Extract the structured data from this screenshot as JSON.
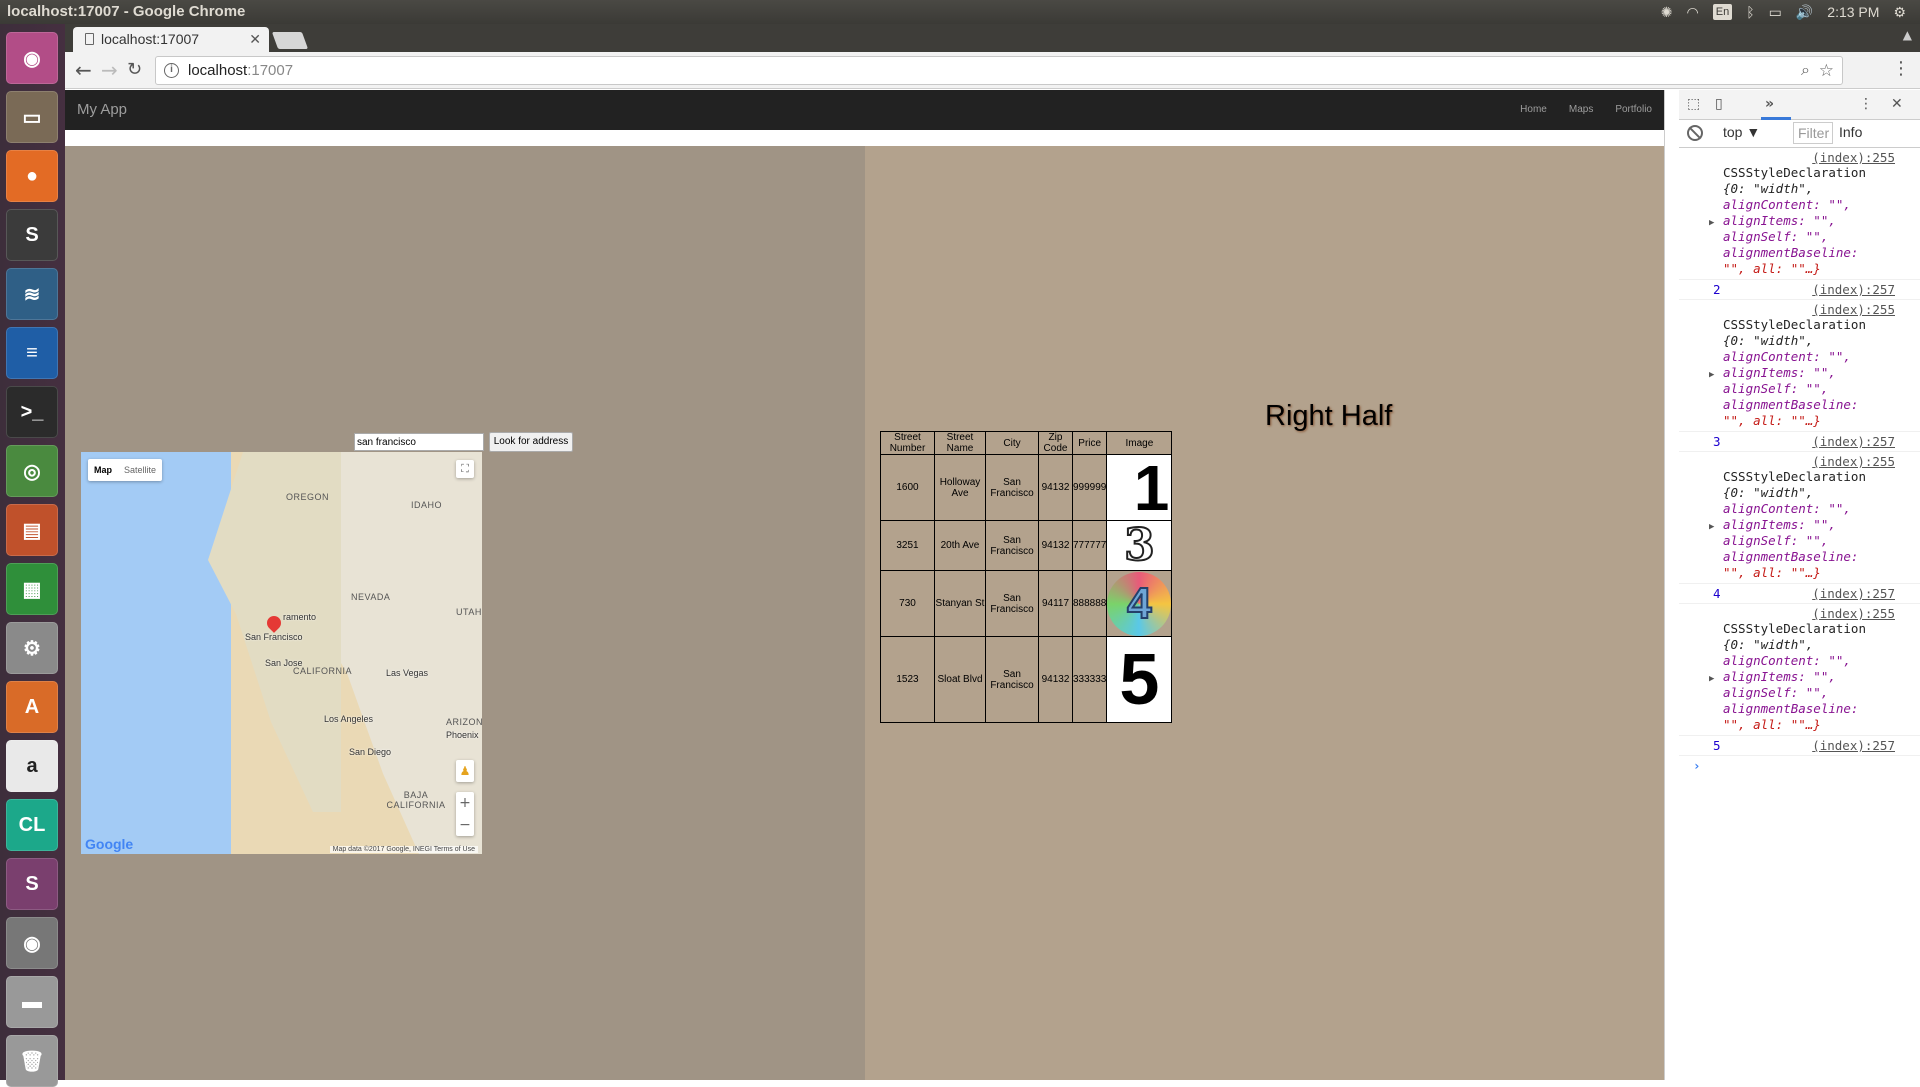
{
  "os": {
    "window_title": "localhost:17007 - Google Chrome",
    "tray": {
      "lang": "En",
      "time": "2:13 PM"
    }
  },
  "launcher": [
    {
      "name": "ubuntu-icon",
      "color": "#b24d87",
      "glyph": "◉"
    },
    {
      "name": "files-icon",
      "color": "#7a6a56",
      "glyph": "▭"
    },
    {
      "name": "firefox-icon",
      "color": "#e36b25",
      "glyph": "●"
    },
    {
      "name": "sublime-icon",
      "color": "#3b3b3b",
      "glyph": "S"
    },
    {
      "name": "mysql-workbench-icon",
      "color": "#2f5f86",
      "glyph": "≋"
    },
    {
      "name": "writer-icon",
      "color": "#1f5ea6",
      "glyph": "≡"
    },
    {
      "name": "terminal-icon",
      "color": "#2b2b2b",
      "glyph": ">_"
    },
    {
      "name": "chrome-icon",
      "color": "#4a8a3f",
      "glyph": "◎"
    },
    {
      "name": "impress-icon",
      "color": "#c0512b",
      "glyph": "▤"
    },
    {
      "name": "calc-icon",
      "color": "#2f8f3a",
      "glyph": "▦"
    },
    {
      "name": "settings-icon",
      "color": "#8a8a8a",
      "glyph": "⚙"
    },
    {
      "name": "software-center-icon",
      "color": "#d96b28",
      "glyph": "A"
    },
    {
      "name": "amazon-icon",
      "color": "#e9e9e9",
      "glyph": "a"
    },
    {
      "name": "clion-icon",
      "color": "#1ca88a",
      "glyph": "CL"
    },
    {
      "name": "slack-icon",
      "color": "#7a3f6e",
      "glyph": "S"
    },
    {
      "name": "camera-icon",
      "color": "#777",
      "glyph": "◉"
    },
    {
      "name": "drive-icon",
      "color": "#999",
      "glyph": "▬"
    },
    {
      "name": "trash-icon",
      "color": "#999",
      "glyph": "🗑"
    }
  ],
  "browser": {
    "tab_title": "localhost:17007",
    "url_host": "localhost",
    "url_port": ":17007"
  },
  "app": {
    "brand": "My App",
    "nav": [
      "Home",
      "Maps",
      "Portfolio"
    ]
  },
  "left": {
    "address_value": "san francisco",
    "find_button": "Look for address",
    "map": {
      "type_map": "Map",
      "type_satellite": "Satellite",
      "labels": [
        "OREGON",
        "IDAHO",
        "NEVADA",
        "UTAH",
        "CALIFORNIA",
        "ARIZON",
        "BAJA CALIFORNIA"
      ],
      "cities": [
        "ramento",
        "San Francisco",
        "San Jose",
        "Las Vegas",
        "Los Angeles",
        "Phoenix",
        "San Diego"
      ],
      "logo": "Google",
      "footer": "Map data ©2017 Google, INEGI    Terms of Use"
    }
  },
  "right": {
    "title": "Right Half",
    "columns": [
      "Street Number",
      "Street Name",
      "City",
      "Zip Code",
      "Price",
      "Image"
    ],
    "rows": [
      {
        "num": "1600",
        "street": "Holloway Ave",
        "city": "San Francisco",
        "zip": "94132",
        "price": "999999",
        "image": "1"
      },
      {
        "num": "3251",
        "street": "20th Ave",
        "city": "San Francisco",
        "zip": "94132",
        "price": "777777",
        "image": "3"
      },
      {
        "num": "730",
        "street": "Stanyan St",
        "city": "San Francisco",
        "zip": "94117",
        "price": "888888",
        "image": "4"
      },
      {
        "num": "1523",
        "street": "Sloat Blvd",
        "city": "San Francisco",
        "zip": "94132",
        "price": "333333",
        "image": "5"
      }
    ]
  },
  "devtools": {
    "context": "top ▼",
    "filter": "Filter",
    "level": "Info",
    "log": [
      {
        "src": "(index):255",
        "text1": "CSSStyleDeclaration",
        "text2": "{0: \"width\",",
        "text3": "alignContent: \"\",",
        "text4": "alignItems: \"\",",
        "text5": "alignSelf: \"\",",
        "text6": "alignmentBaseline:",
        "text7": "\"\", all: \"\"…}",
        "num": "2",
        "src2": "(index):257"
      },
      {
        "src": "(index):255",
        "text1": "CSSStyleDeclaration",
        "text2": "{0: \"width\",",
        "text3": "alignContent: \"\",",
        "text4": "alignItems: \"\",",
        "text5": "alignSelf: \"\",",
        "text6": "alignmentBaseline:",
        "text7": "\"\", all: \"\"…}",
        "num": "3",
        "src2": "(index):257"
      },
      {
        "src": "(index):255",
        "text1": "CSSStyleDeclaration",
        "text2": "{0: \"width\",",
        "text3": "alignContent: \"\",",
        "text4": "alignItems: \"\",",
        "text5": "alignSelf: \"\",",
        "text6": "alignmentBaseline:",
        "text7": "\"\", all: \"\"…}",
        "num": "4",
        "src2": "(index):257"
      },
      {
        "src": "(index):255",
        "text1": "CSSStyleDeclaration",
        "text2": "{0: \"width\",",
        "text3": "alignContent: \"\",",
        "text4": "alignItems: \"\",",
        "text5": "alignSelf: \"\",",
        "text6": "alignmentBaseline:",
        "text7": "\"\", all: \"\"…}",
        "num": "5",
        "src2": "(index):257"
      }
    ]
  }
}
